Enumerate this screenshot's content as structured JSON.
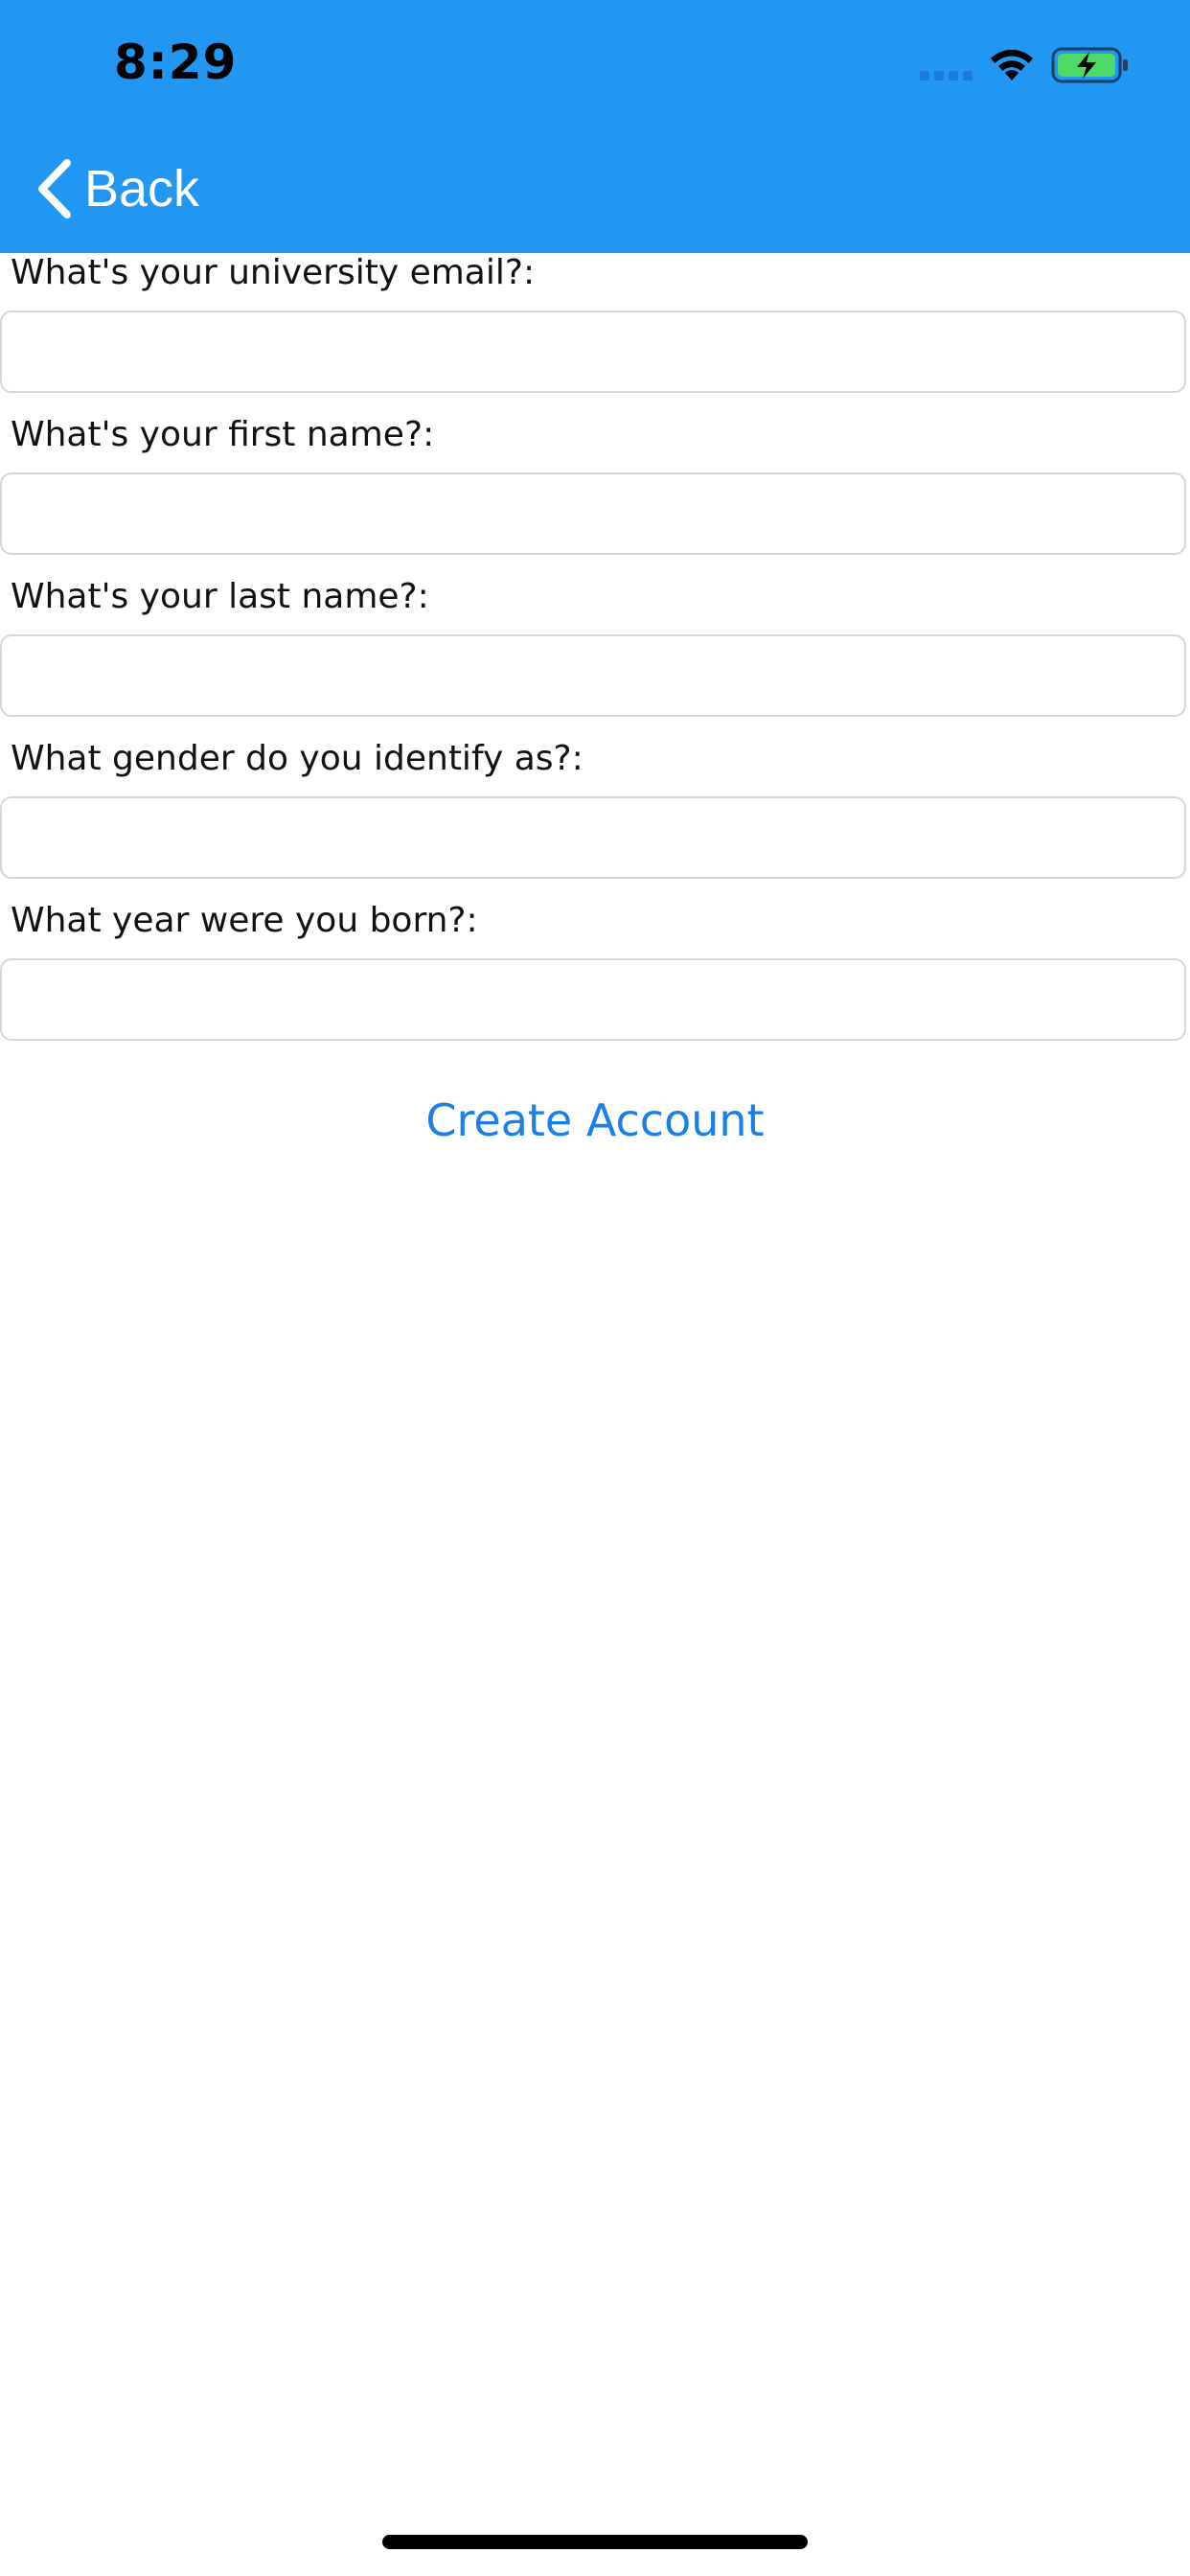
{
  "status_bar": {
    "time": "8:29",
    "icons": [
      "cellular-signal-icon",
      "wifi-icon",
      "battery-charging-icon"
    ]
  },
  "nav": {
    "back_label": "Back",
    "back_icon": "chevron-left-icon"
  },
  "colors": {
    "header_bg": "#2196F3",
    "link": "#1a7fe8",
    "battery_fill": "#4cd964"
  },
  "form": {
    "fields": [
      {
        "label": "What's your university email?:",
        "value": "",
        "placeholder": ""
      },
      {
        "label": "What's your first name?:",
        "value": "",
        "placeholder": ""
      },
      {
        "label": "What's your last name?:",
        "value": "",
        "placeholder": ""
      },
      {
        "label": "What gender do you identify as?:",
        "value": "",
        "placeholder": ""
      },
      {
        "label": "What year were you born?:",
        "value": "",
        "placeholder": ""
      }
    ],
    "submit_label": "Create Account"
  }
}
